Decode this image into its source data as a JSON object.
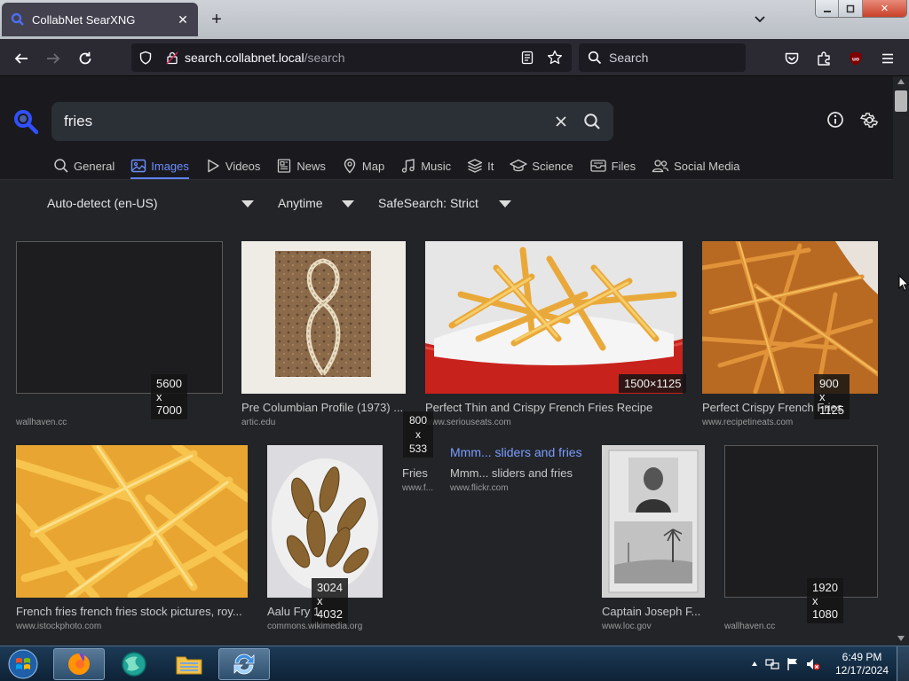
{
  "browser": {
    "tab_title": "CollabNet SearXNG",
    "tab_close": "✕",
    "new_tab": "+",
    "url_host": "search.collabnet.local",
    "url_path": "/search",
    "search_placeholder": "Search",
    "window_close": "✕"
  },
  "search": {
    "query": "fries",
    "categories": [
      {
        "label": "General"
      },
      {
        "label": "Images"
      },
      {
        "label": "Videos"
      },
      {
        "label": "News"
      },
      {
        "label": "Map"
      },
      {
        "label": "Music"
      },
      {
        "label": "It"
      },
      {
        "label": "Science"
      },
      {
        "label": "Files"
      },
      {
        "label": "Social Media"
      }
    ],
    "active_category": "Images",
    "filters": {
      "language": "Auto-detect (en-US)",
      "time": "Anytime",
      "safesearch": "SafeSearch: Strict"
    }
  },
  "results": [
    {
      "title": "",
      "source": "wallhaven.cc",
      "dims": "5600 x 7000"
    },
    {
      "title": "Pre Columbian Profile (1973) ...",
      "source": "artic.edu",
      "dims": ""
    },
    {
      "title": "Perfect Thin and Crispy French Fries Recipe",
      "source": "www.seriouseats.com",
      "dims": "1500×1125"
    },
    {
      "title": "Perfect Crispy French Fries",
      "source": "www.recipetineats.com",
      "dims": "900 x 1125"
    },
    {
      "title": "French fries french fries stock pictures, roy...",
      "source": "www.istockphoto.com",
      "dims": ""
    },
    {
      "title": "Aalu Fry 1",
      "source": "commons.wikimedia.org",
      "dims": "3024 x 4032"
    },
    {
      "title": "Fries",
      "source": "www.f...",
      "dims_lines": [
        "800",
        "x",
        "533"
      ]
    },
    {
      "title": "Mmm... sliders and fries",
      "alt_text": "Mmm... sliders and fries",
      "source": "www.flickr.com"
    },
    {
      "title": "Captain Joseph F...",
      "source": "www.loc.gov",
      "dims": ""
    },
    {
      "title": "",
      "source": "wallhaven.cc",
      "dims": "1920 x 1080"
    }
  ],
  "taskbar": {
    "time": "6:49 PM",
    "date": "12/17/2024"
  },
  "colors": {
    "accent": "#5c83ff",
    "page_bg": "#222428",
    "header_bg": "#1a1a1e"
  }
}
